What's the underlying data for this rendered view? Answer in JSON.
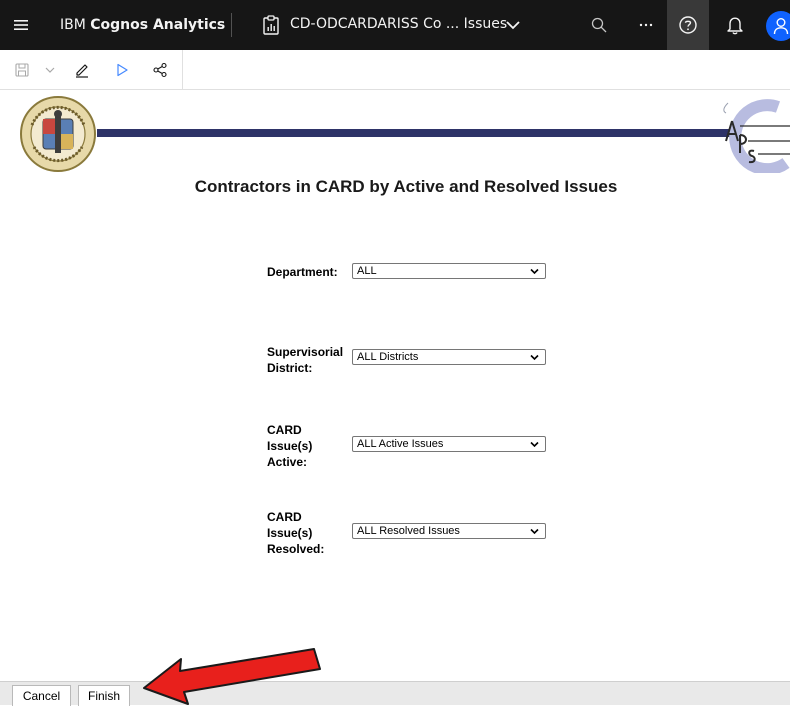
{
  "header": {
    "brand_prefix": "IBM ",
    "brand_name": "Cognos Analytics",
    "report_title": "CD-ODCARDARISS Co ... Issues",
    "icons": [
      "menu-icon",
      "report-icon",
      "chevron-down-icon",
      "search-icon",
      "overflow-menu-icon",
      "help-icon",
      "notification-icon",
      "user-avatar-icon"
    ]
  },
  "toolbar": {
    "icons": [
      "save-icon",
      "save-menu-chevron-icon",
      "edit-icon",
      "run-icon",
      "share-icon"
    ]
  },
  "report": {
    "heading": "Contractors in CARD by Active and Resolved Issues",
    "banner_color": "#2e3368"
  },
  "prompts": [
    {
      "label": "Department:",
      "value": "ALL"
    },
    {
      "label": "Supervisorial District:",
      "value": "ALL Districts"
    },
    {
      "label": "CARD Issue(s) Active:",
      "value": "ALL Active Issues"
    },
    {
      "label": "CARD Issue(s) Resolved:",
      "value": "ALL Resolved Issues"
    }
  ],
  "footer": {
    "cancel_label": "Cancel",
    "finish_label": "Finish"
  },
  "colors": {
    "topbar": "#161616",
    "avatar": "#0f62fe",
    "annotation_arrow": "#e8201c"
  }
}
